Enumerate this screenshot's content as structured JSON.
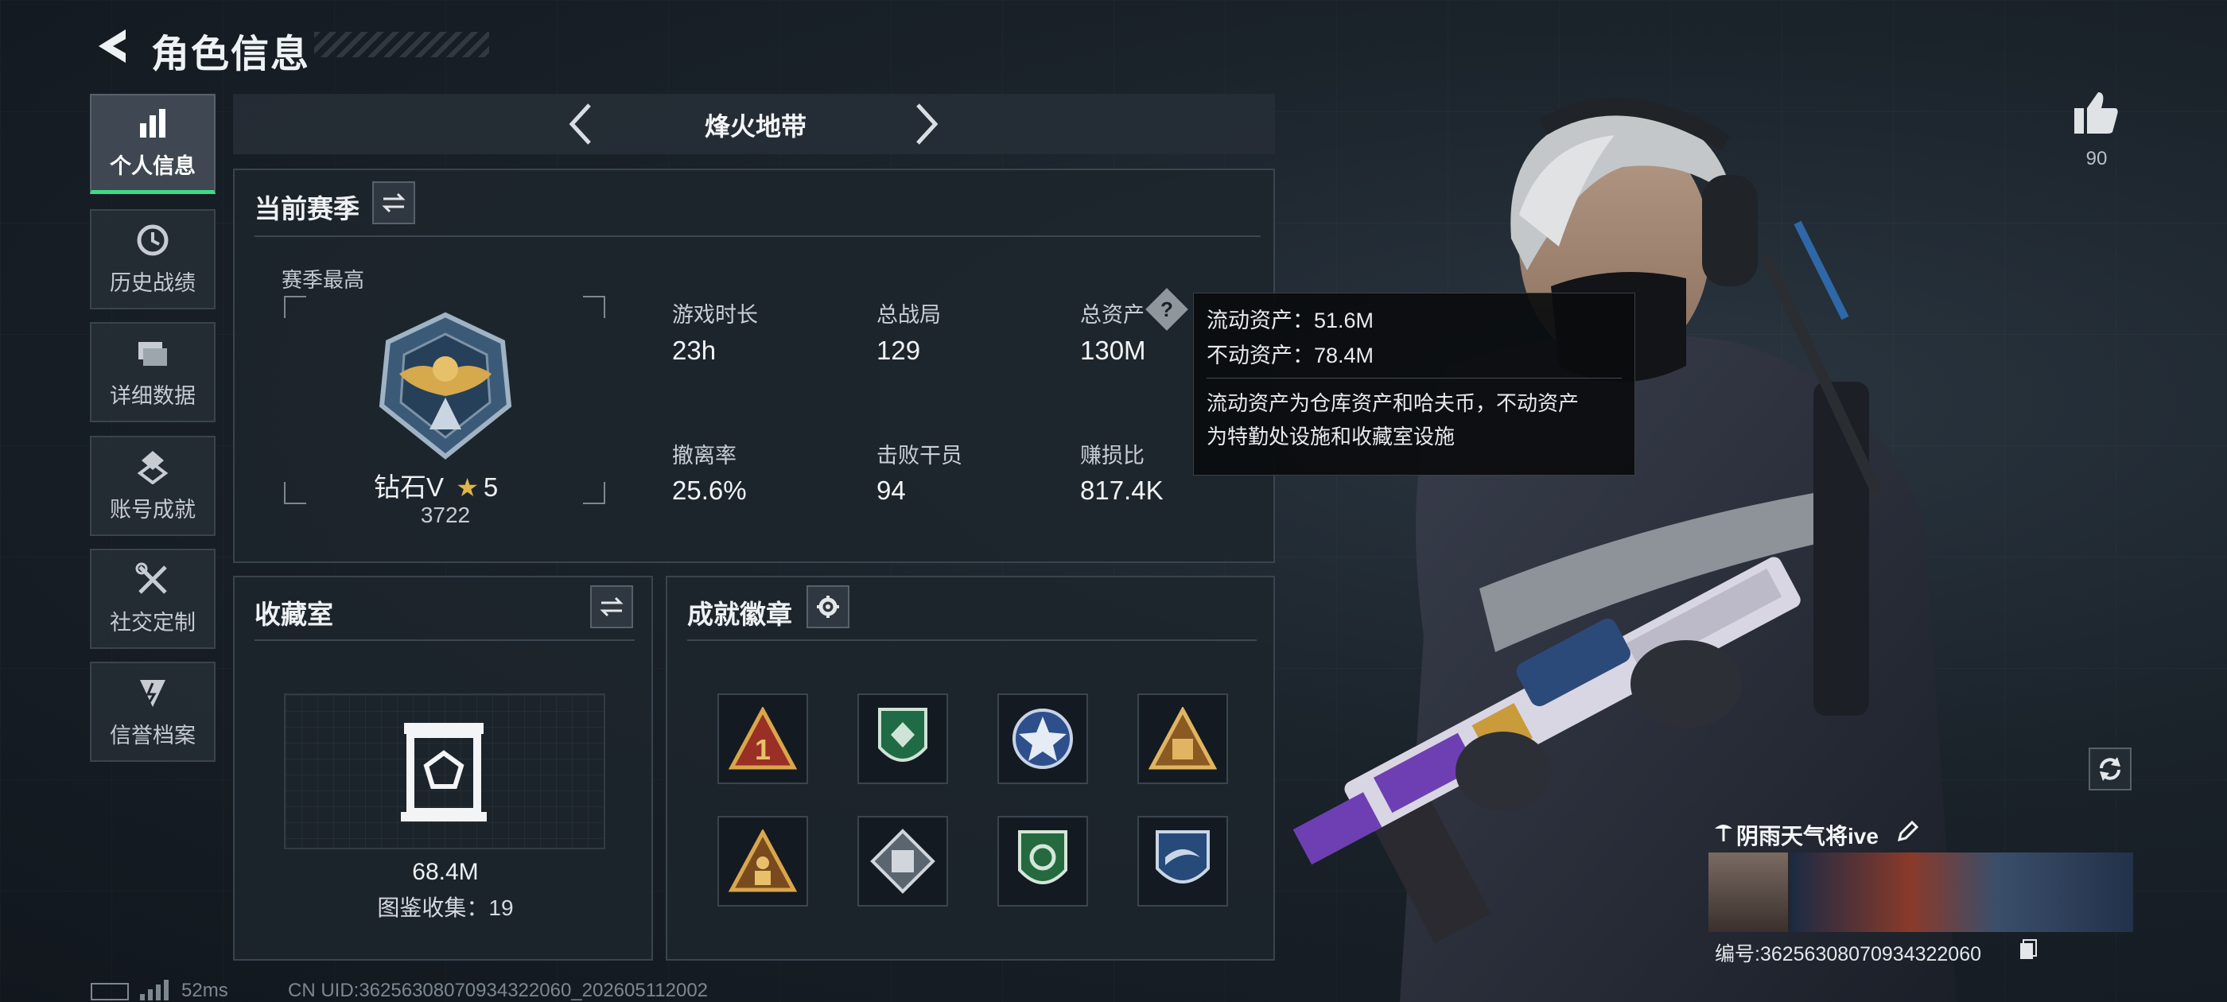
{
  "header": {
    "title": "角色信息"
  },
  "sidebar": {
    "items": [
      {
        "label": "个人信息",
        "icon": "bar-chart-icon",
        "active": true
      },
      {
        "label": "历史战绩",
        "icon": "clock-icon"
      },
      {
        "label": "详细数据",
        "icon": "folder-icon"
      },
      {
        "label": "账号成就",
        "icon": "achievement-icon"
      },
      {
        "label": "社交定制",
        "icon": "tools-icon"
      },
      {
        "label": "信誉档案",
        "icon": "shield-icon"
      }
    ]
  },
  "mode": {
    "label": "烽火地带"
  },
  "season": {
    "title": "当前赛季",
    "best_label": "赛季最高",
    "rank_name": "钻石V",
    "stars": "5",
    "rank_score": "3722",
    "stats": [
      {
        "label": "游戏时长",
        "value": "23h"
      },
      {
        "label": "总战局",
        "value": "129"
      },
      {
        "label": "总资产",
        "value": "130M"
      },
      {
        "label": "撤离率",
        "value": "25.6%"
      },
      {
        "label": "击败干员",
        "value": "94"
      },
      {
        "label": "赚损比",
        "value": "817.4K"
      }
    ]
  },
  "tooltip": {
    "line1": "流动资产：51.6M",
    "line2": "不动资产：78.4M",
    "desc1": "流动资产为仓库资产和哈夫币，不动资产",
    "desc2": "为特勤处设施和收藏室设施"
  },
  "collection": {
    "title": "收藏室",
    "value": "68.4M",
    "count_text": "图鉴收集：19"
  },
  "achievements": {
    "title": "成就徽章",
    "badges": [
      {
        "icon": "triangle-rank-1-badge-icon"
      },
      {
        "icon": "green-shield-badge-icon"
      },
      {
        "icon": "blue-star-badge-icon"
      },
      {
        "icon": "gold-triangle-badge-icon"
      },
      {
        "icon": "gold-triangle-figure-badge-icon"
      },
      {
        "icon": "diamond-cube-badge-icon"
      },
      {
        "icon": "green-emblem-badge-icon"
      },
      {
        "icon": "blue-wing-badge-icon"
      }
    ]
  },
  "social": {
    "likes": "90"
  },
  "player": {
    "name": "阴雨天气将ive",
    "id_text": "编号:3625630807093432​2060"
  },
  "footer": {
    "ping": "52ms",
    "uid": "CN UID:3625630807093432​2060_202605112002"
  },
  "colors": {
    "accent_green": "#3ddc84",
    "panel_bg": "#1e252c",
    "border": "#3a444e"
  }
}
